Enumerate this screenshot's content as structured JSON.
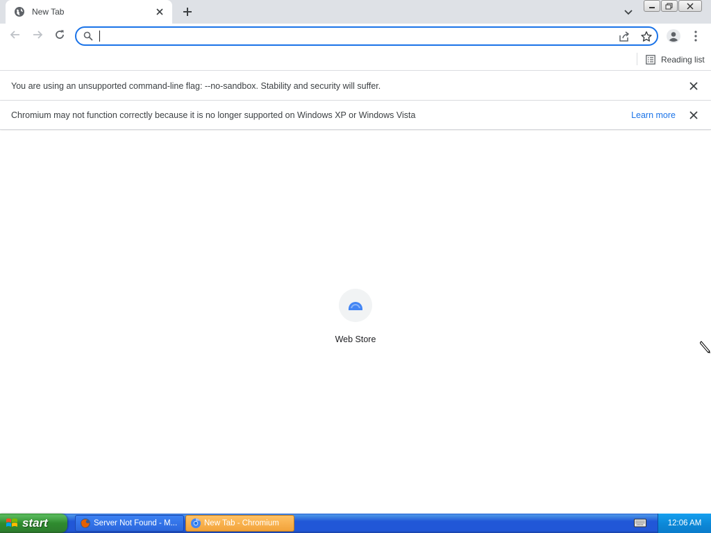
{
  "browser": {
    "tab": {
      "title": "New Tab"
    },
    "omnibox": {
      "value": "",
      "placeholder": ""
    },
    "bookmarks": {
      "reading_list_label": "Reading list"
    }
  },
  "infobars": [
    {
      "message": "You are using an unsupported command-line flag: --no-sandbox. Stability and security will suffer."
    },
    {
      "message": "Chromium may not function correctly because it is no longer supported on Windows XP or Windows Vista",
      "link": "Learn more"
    }
  ],
  "new_tab_page": {
    "shortcuts": [
      {
        "label": "Web Store",
        "icon": "web-store-icon"
      }
    ]
  },
  "taskbar": {
    "start_label": "start",
    "tasks": [
      {
        "label": "Server Not Found - M...",
        "icon": "firefox-icon",
        "active": false
      },
      {
        "label": "New Tab - Chromium",
        "icon": "chromium-icon",
        "active": true
      }
    ],
    "clock": "12:06 AM"
  },
  "colors": {
    "accent": "#1a73e8",
    "tabstrip": "#dee1e6",
    "taskbar": "#2157d7",
    "start": "#3c9a3c",
    "active_task": "#f2a33a"
  }
}
